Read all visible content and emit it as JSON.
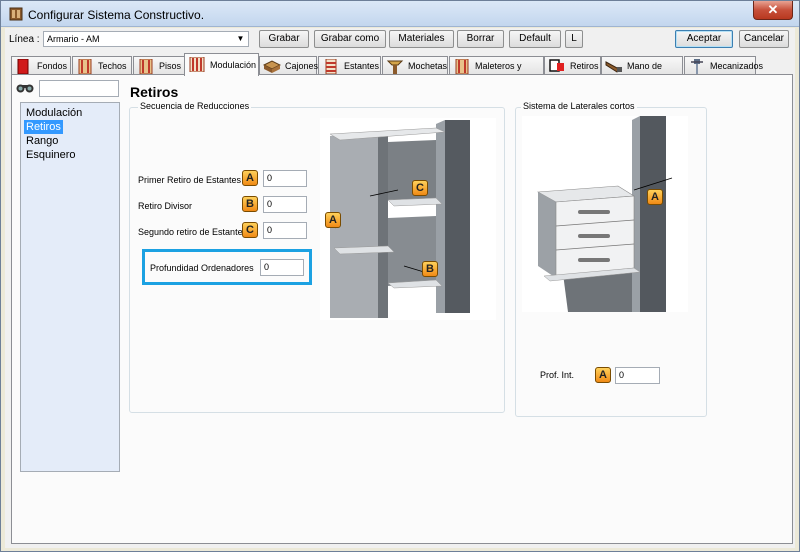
{
  "window": {
    "title": "Configurar Sistema Constructivo.",
    "close_glyph": "✕"
  },
  "toolbar": {
    "line_label": "Línea :",
    "line_value": "Armario - AM",
    "grabar": "Grabar",
    "grabar_como": "Grabar como",
    "materiales": "Materiales",
    "borrar": "Borrar",
    "default": "Default",
    "l": "L",
    "aceptar": "Aceptar",
    "cancelar": "Cancelar"
  },
  "tabs": [
    {
      "label": "Fondos",
      "icon": "panel-red-icon"
    },
    {
      "label": "Techos",
      "icon": "cabinet-icon"
    },
    {
      "label": "Pisos",
      "icon": "cabinet-icon"
    },
    {
      "label": "Modulación",
      "icon": "modulation-icon"
    },
    {
      "label": "Cajones",
      "icon": "drawer-icon"
    },
    {
      "label": "Estantes",
      "icon": "shelves-icon"
    },
    {
      "label": "Mochetas",
      "icon": "mocheta-icon"
    },
    {
      "label": "Maleteros y Altillos",
      "icon": "cabinet-icon"
    },
    {
      "label": "Retiros",
      "icon": "retiros-icon"
    },
    {
      "label": "Mano de Obra",
      "icon": "saw-icon"
    },
    {
      "label": "Mecanizados",
      "icon": "drill-icon"
    }
  ],
  "tree": {
    "items": [
      "Modulación",
      "Retiros",
      "Rango",
      "Esquinero"
    ],
    "selected": "Retiros"
  },
  "content": {
    "heading": "Retiros",
    "group_left_title": "Secuencia de Reducciones",
    "group_right_title": "Sistema de Laterales cortos",
    "fields": {
      "primer_label": "Primer Retiro de Estantes",
      "primer_badge": "A",
      "primer_value": "0",
      "divisor_label": "Retiro Divisor",
      "divisor_badge": "B",
      "divisor_value": "0",
      "segundo_label": "Segundo retiro de Estantes",
      "segundo_badge": "C",
      "segundo_value": "0",
      "prof_ord_label": "Profundidad Ordenadores",
      "prof_ord_value": "0",
      "prof_int_label": "Prof. Int.",
      "prof_int_badge": "A",
      "prof_int_value": "0"
    },
    "diagram_left_badges": {
      "a": "A",
      "b": "B",
      "c": "C"
    },
    "diagram_right_badges": {
      "a": "A"
    }
  },
  "colors": {
    "highlight": "#1ba1e2",
    "badge": "#f5a623",
    "selection": "#3399ff"
  }
}
